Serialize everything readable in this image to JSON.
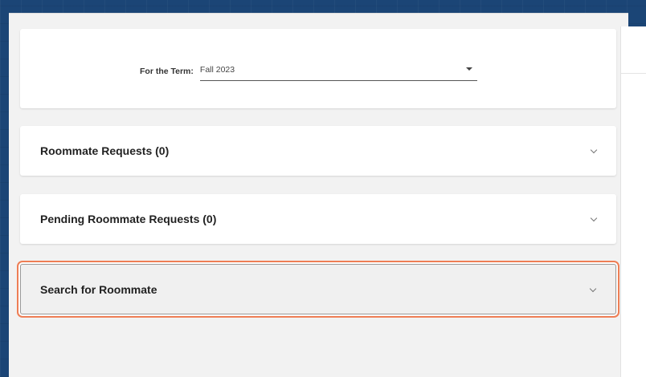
{
  "term": {
    "label": "For the Term:",
    "selected": "Fall 2023"
  },
  "accordions": [
    {
      "title": "Roommate Requests (0)"
    },
    {
      "title": "Pending Roommate Requests (0)"
    },
    {
      "title": "Search for Roommate",
      "focused": true
    }
  ],
  "colors": {
    "page_background": "#1b4576",
    "focus_outline": "#ee7e55",
    "card": "#ffffff"
  },
  "icons": [
    "caret-down-icon",
    "chevron-down-icon"
  ]
}
